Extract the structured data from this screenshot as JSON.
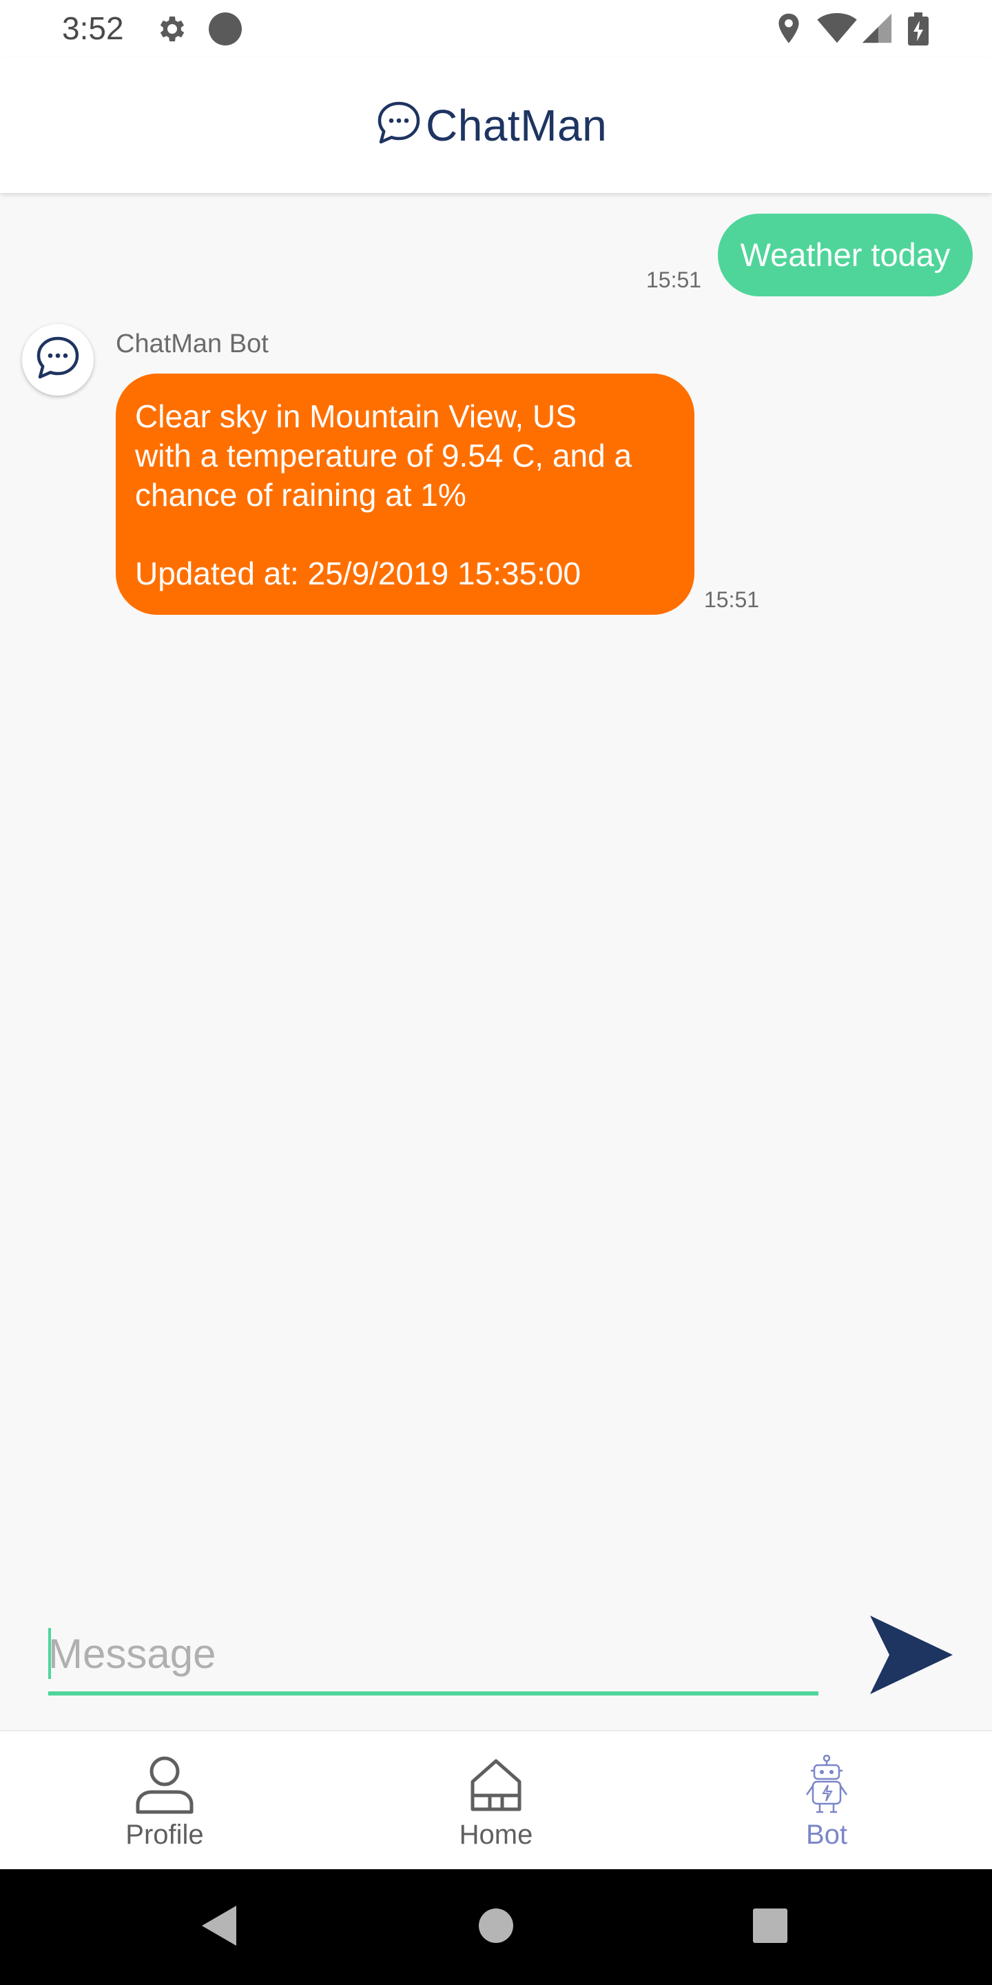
{
  "status_bar": {
    "time": "3:52"
  },
  "header": {
    "title": "ChatMan",
    "logo_icon": "chat-bubble-dots-icon"
  },
  "chat": {
    "messages": [
      {
        "sender": "user",
        "text": "Weather today",
        "time": "15:51"
      },
      {
        "sender": "bot",
        "bot_name": "ChatMan Bot",
        "lines": [
          "Clear sky in Mountain View, US",
          "with a temperature of 9.54 C, and a",
          "chance of raining at 1%"
        ],
        "updated": "Updated at: 25/9/2019 15:35:00",
        "time": "15:51"
      }
    ]
  },
  "composer": {
    "placeholder": "Message",
    "value": ""
  },
  "bottom_nav": {
    "items": [
      {
        "label": "Profile",
        "icon": "person-icon"
      },
      {
        "label": "Home",
        "icon": "house-icon"
      },
      {
        "label": "Bot",
        "icon": "robot-icon",
        "active": true
      }
    ]
  },
  "colors": {
    "brand_navy": "#1e3461",
    "user_bubble": "#4fd59a",
    "bot_bubble": "#ff6f00",
    "nav_active": "#7b86c9"
  }
}
